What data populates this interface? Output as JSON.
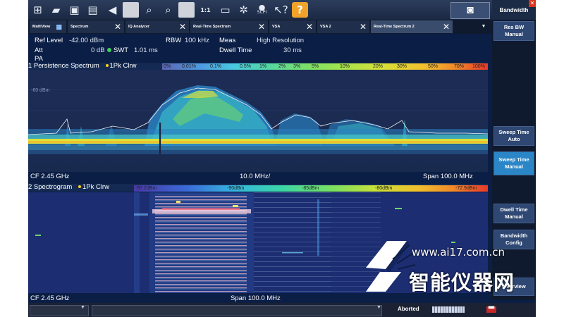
{
  "toolbar": {
    "icons": [
      "windows-icon",
      "open-folder-icon",
      "save-icon",
      "print-icon",
      "undo-icon",
      "blank-icon",
      "zoom-icon",
      "multi-zoom-icon",
      "blank-icon",
      "zoom-1to1-icon",
      "full-screen-icon",
      "run-sequence-icon",
      "scpi-icon",
      "help-pointer-icon",
      "help-icon"
    ],
    "scpi_label": "SCPI",
    "zoom_label": "1:1",
    "help_label": "?"
  },
  "tabs": [
    {
      "label": "MultiView"
    },
    {
      "label": "Spectrum"
    },
    {
      "label": "IQ Analyzer"
    },
    {
      "label": "Real-Time Spectrum"
    },
    {
      "label": "VSA"
    },
    {
      "label": "VSA 2"
    },
    {
      "label": "Real-Time Spectrum 2"
    }
  ],
  "settings": {
    "ref_level_label": "Ref Level",
    "ref_level_value": "-42.00 dBm",
    "att_label": "Att",
    "att_value": "0 dB",
    "swt_label": "SWT",
    "swt_value": "1.01 ms",
    "rbw_label": "RBW",
    "rbw_value": "100 kHz",
    "meas_label": "Meas",
    "meas_value": "High Resolution",
    "dwell_label": "Dwell Time",
    "dwell_value": "30 ms",
    "pa_label": "PA"
  },
  "panel1": {
    "title": "1 Persistence Spectrum",
    "trace": "1Pk Clrw",
    "colorbar_labels": [
      "0%",
      "0.01%",
      "0.1%",
      "0.5%",
      "1%",
      "2%",
      "3%",
      "5%",
      "10%",
      "20%",
      "30%",
      "50%",
      "70%",
      "100%"
    ],
    "y_ref_label": "-60 dBm",
    "cf": "CF 2.45 GHz",
    "div": "10.0 MHz/",
    "span": "Span 100.0 MHz"
  },
  "panel2": {
    "title": "2 Spectrogram",
    "trace": "1Pk Clrw",
    "colorbar_labels": [
      "-97.2dBm",
      "-90dBm",
      "-85dBm",
      "-80dBm",
      "-72.9dBm"
    ],
    "cf": "CF 2.45 GHz",
    "span": "Span 100.0 MHz"
  },
  "softkeys": {
    "title": "Bandwidth",
    "items": [
      {
        "label": "Res BW Manual"
      },
      {
        "label": "Sweep Time Auto"
      },
      {
        "label": "Sweep Time Manual"
      },
      {
        "label": "Dwell Time Manual"
      },
      {
        "label": "Bandwidth Config"
      },
      {
        "label": "Overview"
      }
    ]
  },
  "status": {
    "text": "Aborted"
  },
  "watermark": {
    "url": "www.ai17.com.cn",
    "text": "智能仪器网"
  }
}
